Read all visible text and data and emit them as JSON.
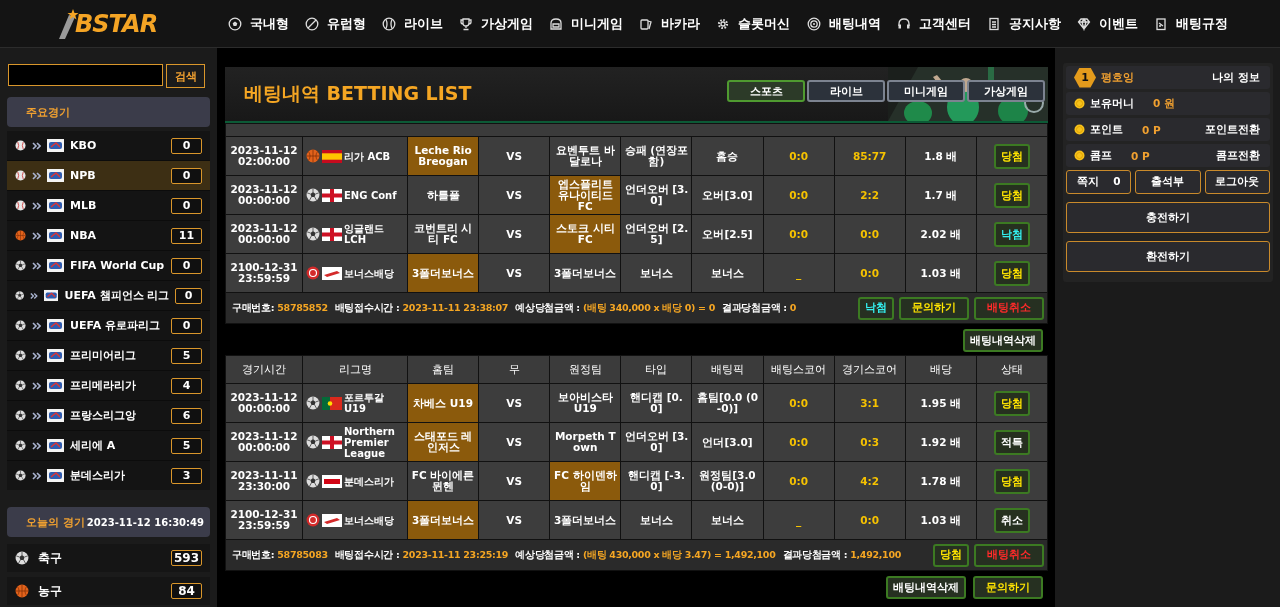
{
  "header": {
    "logo": "BSTAR",
    "menu": [
      {
        "label": "국내형"
      },
      {
        "label": "유럽형"
      },
      {
        "label": "라이브"
      },
      {
        "label": "가상게임"
      },
      {
        "label": "미니게임"
      },
      {
        "label": "바카라"
      },
      {
        "label": "슬롯머신"
      },
      {
        "label": "배팅내역"
      },
      {
        "label": "고객센터"
      },
      {
        "label": "공지사항"
      },
      {
        "label": "이벤트"
      },
      {
        "label": "배팅규정"
      }
    ]
  },
  "sidebar": {
    "search": {
      "button": "검색"
    },
    "featured": {
      "title": "주요경기",
      "leagues": [
        {
          "kind": "baseball",
          "name": "KBO",
          "count": "0",
          "selected": false
        },
        {
          "kind": "baseball",
          "name": "NPB",
          "count": "0",
          "selected": true
        },
        {
          "kind": "baseball",
          "name": "MLB",
          "count": "0",
          "selected": false
        },
        {
          "kind": "basketball",
          "name": "NBA",
          "count": "11",
          "selected": false
        },
        {
          "kind": "soccer",
          "name": "FIFA World Cup",
          "count": "0",
          "selected": false
        },
        {
          "kind": "soccer",
          "name": "UEFA 챔피언스 리그",
          "count": "0",
          "selected": false
        },
        {
          "kind": "soccer",
          "name": "UEFA 유로파리그",
          "count": "0",
          "selected": false
        },
        {
          "kind": "soccer",
          "name": "프리미어리그",
          "count": "5",
          "selected": false
        },
        {
          "kind": "soccer",
          "name": "프리메라리가",
          "count": "4",
          "selected": false
        },
        {
          "kind": "soccer",
          "name": "프랑스리그앙",
          "count": "6",
          "selected": false
        },
        {
          "kind": "soccer",
          "name": "세리에 A",
          "count": "5",
          "selected": false
        },
        {
          "kind": "soccer",
          "name": "분데스리가",
          "count": "3",
          "selected": false
        }
      ]
    },
    "today": {
      "title": "오늘의 경기",
      "datetime": "2023-11-12 16:30:49",
      "sports": [
        {
          "kind": "soccer",
          "name": "축구",
          "count": "593"
        },
        {
          "kind": "basketball",
          "name": "농구",
          "count": "84"
        }
      ]
    }
  },
  "betting": {
    "title": "베팅내역 BETTING LIST",
    "tabs": [
      {
        "label": "스포츠",
        "selected": true
      },
      {
        "label": "라이브",
        "selected": false
      },
      {
        "label": "미니게임",
        "selected": false
      },
      {
        "label": "가상게임",
        "selected": false
      }
    ],
    "slips": [
      {
        "rows": [
          {
            "time": "2023-11-12 02:00:00",
            "league": {
              "kind": "basketball",
              "flag": {
                "kind": "spain"
              },
              "name": "리가 ACB"
            },
            "home": {
              "name": "Leche Rio Breogan",
              "selected": true
            },
            "draw": "VS",
            "away": {
              "name": "요벤투트 바달로나",
              "selected": false
            },
            "type": "승패 (연장포함)",
            "pick": "홈승",
            "bet_score": "0:0",
            "game_score": "85:77",
            "odds": "1.8 배",
            "status": {
              "label": "당첨",
              "kind": "win"
            }
          },
          {
            "time": "2023-11-12 00:00:00",
            "league": {
              "kind": "soccer",
              "flag": {
                "kind": "england"
              },
              "name": "ENG Conf"
            },
            "home": {
              "name": "하틀풀",
              "selected": false
            },
            "draw": "VS",
            "away": {
              "name": "엡스플리트 유나이티드 FC",
              "selected": true
            },
            "type": "언더오버 [3.0]",
            "pick": "오버[3.0]",
            "bet_score": "0:0",
            "game_score": "2:2",
            "odds": "1.7 배",
            "status": {
              "label": "당첨",
              "kind": "win"
            }
          },
          {
            "time": "2023-11-12 00:00:00",
            "league": {
              "kind": "soccer",
              "flag": {
                "kind": "england"
              },
              "name": "잉글랜드 LCH"
            },
            "home": {
              "name": "코번트리 시티 FC",
              "selected": false
            },
            "draw": "VS",
            "away": {
              "name": "스토크 시티 FC",
              "selected": true
            },
            "type": "언더오버 [2.5]",
            "pick": "오버[2.5]",
            "bet_score": "0:0",
            "game_score": "0:0",
            "odds": "2.02 배",
            "status": {
              "label": "낙첨",
              "kind": "lose"
            }
          },
          {
            "time": "2100-12-31 23:59:59",
            "league": {
              "kind": "bonus",
              "flag": {
                "kind": "bonus"
              },
              "name": "보너스배당"
            },
            "home": {
              "name": "3폴더보너스",
              "selected": true
            },
            "draw": "VS",
            "away": {
              "name": "3폴더보너스",
              "selected": false
            },
            "type": "보너스",
            "pick": "보너스",
            "bet_score": "_",
            "game_score": "0:0",
            "odds": "1.03 배",
            "status": {
              "label": "당첨",
              "kind": "win"
            }
          }
        ],
        "summary": [
          {
            "label": "구매번호:",
            "value": "58785852"
          },
          {
            "label": "배팅접수시간 :",
            "value": "2023-11-11 23:38:07"
          },
          {
            "label": "예상당첨금액 :",
            "value": "(배팅 340,000 x 배당 0) = 0"
          },
          {
            "label": "결과당첨금액 :",
            "value": "0"
          }
        ],
        "buttons": [
          {
            "label": "낙첨",
            "kind": "lose"
          },
          {
            "label": "문의하기",
            "kind": "inquiry"
          },
          {
            "label": "배팅취소",
            "kind": "cancel"
          }
        ],
        "actions": [
          {
            "label": "배팅내역삭제",
            "kind": "delete"
          }
        ]
      },
      {
        "columns": [
          "경기시간",
          "리그명",
          "홈팀",
          "무",
          "원정팀",
          "타입",
          "배팅픽",
          "배팅스코어",
          "경기스코어",
          "배당",
          "상태"
        ],
        "rows": [
          {
            "time": "2023-11-12 00:00:00",
            "league": {
              "kind": "soccer",
              "flag": {
                "kind": "portugal"
              },
              "name": "포르투갈 U19"
            },
            "home": {
              "name": "차베스 U19",
              "selected": true
            },
            "draw": "VS",
            "away": {
              "name": "보아비스타 U19",
              "selected": false
            },
            "type": "핸디캡 [0.0]",
            "pick": "홈팀[0.0 (0-0)]",
            "bet_score": "0:0",
            "game_score": "3:1",
            "odds": "1.95 배",
            "status": {
              "label": "당첨",
              "kind": "win"
            }
          },
          {
            "time": "2023-11-12 00:00:00",
            "league": {
              "kind": "soccer",
              "flag": {
                "kind": "england"
              },
              "name": "Northern Premier League"
            },
            "home": {
              "name": "스태포드 레인저스",
              "selected": true
            },
            "draw": "VS",
            "away": {
              "name": "Morpeth Town",
              "selected": false
            },
            "type": "언더오버 [3.0]",
            "pick": "언더[3.0]",
            "bet_score": "0:0",
            "game_score": "0:3",
            "odds": "1.92 배",
            "status": {
              "label": "적특",
              "kind": "void"
            }
          },
          {
            "time": "2023-11-11 23:30:00",
            "league": {
              "kind": "soccer",
              "flag": {
                "kind": "bundesliga"
              },
              "name": "분데스리가"
            },
            "home": {
              "name": "FC 바이에른 뮌헨",
              "selected": false
            },
            "draw": "VS",
            "away": {
              "name": "FC 하이덴하임",
              "selected": true
            },
            "type": "핸디캡 [-3.0]",
            "pick": "원정팀[3.0 (0-0)]",
            "bet_score": "0:0",
            "game_score": "4:2",
            "odds": "1.78 배",
            "status": {
              "label": "당첨",
              "kind": "win"
            }
          },
          {
            "time": "2100-12-31 23:59:59",
            "league": {
              "kind": "bonus",
              "flag": {
                "kind": "bonus"
              },
              "name": "보너스배당"
            },
            "home": {
              "name": "3폴더보너스",
              "selected": true
            },
            "draw": "VS",
            "away": {
              "name": "3폴더보너스",
              "selected": false
            },
            "type": "보너스",
            "pick": "보너스",
            "bet_score": "_",
            "game_score": "0:0",
            "odds": "1.03 배",
            "status": {
              "label": "취소",
              "kind": "cancel"
            }
          }
        ],
        "summary": [
          {
            "label": "구매번호:",
            "value": "58785083"
          },
          {
            "label": "배팅접수시간 :",
            "value": "2023-11-11 23:25:19"
          },
          {
            "label": "예상당첨금액 :",
            "value": "(배팅 430,000 x 배당 3.47) = 1,492,100"
          },
          {
            "label": "결과당첨금액 :",
            "value": "1,492,100"
          }
        ],
        "buttons": [
          {
            "label": "당첨",
            "kind": "win"
          },
          {
            "label": "배팅취소",
            "kind": "cancel"
          }
        ],
        "actions": [
          {
            "label": "배팅내역삭제",
            "kind": "delete"
          },
          {
            "label": "문의하기",
            "kind": "inquiry"
          }
        ]
      }
    ]
  },
  "user": {
    "rank": "1",
    "name": "평호잉",
    "info_link": "나의 정보",
    "balances": [
      {
        "label": "보유머니",
        "value": "0 원"
      },
      {
        "label": "포인트",
        "value": "0 P",
        "action": "포인트전환"
      },
      {
        "label": "콤프",
        "value": "0 P",
        "action": "콤프전환"
      }
    ],
    "message": {
      "label": "쪽지",
      "count": "0"
    },
    "buttons": [
      "출석부",
      "로그아웃"
    ],
    "wide_buttons": [
      "충전하기",
      "환전하기"
    ]
  }
}
